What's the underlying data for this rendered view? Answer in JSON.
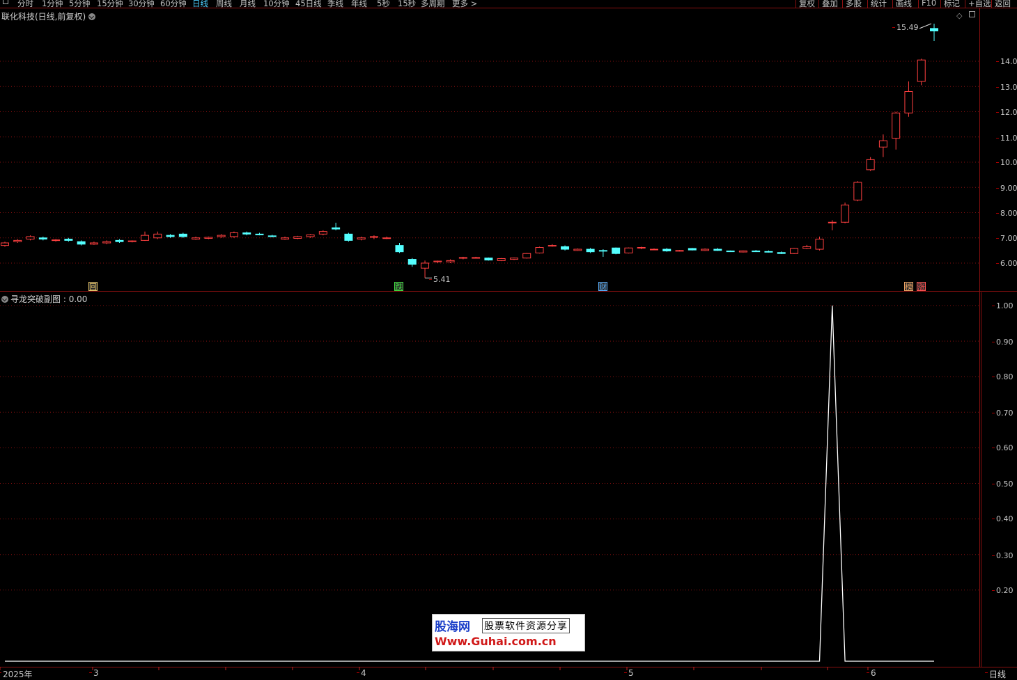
{
  "toolbar": {
    "period_tabs": [
      "分时",
      "1分钟",
      "5分钟",
      "15分钟",
      "30分钟",
      "60分钟",
      "日线",
      "周线",
      "月线",
      "10分钟",
      "45日线",
      "季线",
      "年线",
      "5秒",
      "15秒",
      "多周期",
      "更多 >"
    ],
    "active_period": "日线",
    "right_tabs": [
      "复权",
      "叠加",
      "多股",
      "统计",
      "画线",
      "F10",
      "标记",
      "+自选",
      "返回"
    ]
  },
  "price_panel": {
    "title": "联化科技(日线,前复权)",
    "y_ticks": [
      "14.00",
      "13.00",
      "12.00",
      "11.00",
      "10.00",
      "9.00",
      "8.00",
      "7.00",
      "6.00"
    ],
    "high_label": "15.49",
    "low_label": "5.41",
    "events": [
      {
        "label": "回",
        "color": "#e8c66a"
      },
      {
        "label": "跌",
        "color": "#40e040"
      },
      {
        "label": "财",
        "color": "#58b0ff"
      },
      {
        "label": "榜",
        "color": "#e8a060"
      },
      {
        "label": "涨",
        "color": "#ff5050"
      }
    ]
  },
  "indicator_panel": {
    "title": "寻龙突破副图",
    "value_sep": " : ",
    "value": "0.00",
    "y_ticks": [
      "1.00",
      "0.90",
      "0.80",
      "0.70",
      "0.60",
      "0.50",
      "0.40",
      "0.30",
      "0.20"
    ]
  },
  "x_axis": {
    "year_label": "2025年",
    "month_labels": [
      "3",
      "4",
      "5",
      "6"
    ],
    "period_button": "日线"
  },
  "watermark": {
    "logo": "股海网",
    "slogan": "股票软件资源分享",
    "url": "Www.Guhai.com.cn"
  },
  "colors": {
    "up": "#ff4040",
    "down": "#54ffff",
    "grid": "#8a1010",
    "indicator_line": "#ffffff",
    "active_tab": "#4fd0ff"
  },
  "chart_data": {
    "type": "candlestick",
    "ohlc": [
      [
        6.7,
        6.85,
        6.65,
        6.8
      ],
      [
        6.85,
        6.95,
        6.8,
        6.9
      ],
      [
        6.95,
        7.1,
        6.9,
        7.05
      ],
      [
        7.0,
        7.05,
        6.9,
        6.95
      ],
      [
        6.9,
        6.95,
        6.85,
        6.92
      ],
      [
        6.95,
        7.0,
        6.85,
        6.9
      ],
      [
        6.85,
        6.9,
        6.7,
        6.75
      ],
      [
        6.75,
        6.85,
        6.72,
        6.8
      ],
      [
        6.8,
        6.9,
        6.75,
        6.85
      ],
      [
        6.9,
        6.95,
        6.8,
        6.85
      ],
      [
        6.85,
        6.9,
        6.82,
        6.88
      ],
      [
        6.9,
        7.25,
        6.88,
        7.1
      ],
      [
        7.0,
        7.25,
        6.95,
        7.15
      ],
      [
        7.1,
        7.15,
        7.0,
        7.05
      ],
      [
        7.15,
        7.2,
        7.0,
        7.05
      ],
      [
        6.95,
        7.05,
        6.92,
        7.0
      ],
      [
        6.98,
        7.05,
        6.95,
        7.02
      ],
      [
        7.05,
        7.15,
        7.0,
        7.1
      ],
      [
        7.05,
        7.25,
        7.0,
        7.2
      ],
      [
        7.2,
        7.25,
        7.1,
        7.15
      ],
      [
        7.15,
        7.2,
        7.1,
        7.12
      ],
      [
        7.08,
        7.12,
        7.02,
        7.05
      ],
      [
        6.95,
        7.05,
        6.92,
        7.0
      ],
      [
        6.98,
        7.08,
        6.95,
        7.05
      ],
      [
        7.05,
        7.15,
        7.0,
        7.12
      ],
      [
        7.15,
        7.3,
        7.1,
        7.25
      ],
      [
        7.4,
        7.6,
        7.3,
        7.35
      ],
      [
        7.15,
        7.2,
        6.85,
        6.9
      ],
      [
        6.95,
        7.05,
        6.9,
        7.0
      ],
      [
        7.05,
        7.1,
        6.95,
        7.05
      ],
      [
        7.0,
        7.05,
        6.95,
        7.0
      ],
      [
        6.7,
        6.8,
        6.4,
        6.45
      ],
      [
        6.15,
        6.2,
        5.85,
        5.95
      ],
      [
        5.8,
        6.1,
        5.41,
        6.0
      ],
      [
        6.05,
        6.1,
        6.0,
        6.08
      ],
      [
        6.05,
        6.15,
        6.0,
        6.1
      ],
      [
        6.2,
        6.25,
        6.15,
        6.22
      ],
      [
        6.2,
        6.25,
        6.18,
        6.22
      ],
      [
        6.2,
        6.22,
        6.1,
        6.12
      ],
      [
        6.1,
        6.2,
        6.08,
        6.18
      ],
      [
        6.15,
        6.22,
        6.12,
        6.2
      ],
      [
        6.2,
        6.4,
        6.18,
        6.38
      ],
      [
        6.4,
        6.65,
        6.38,
        6.62
      ],
      [
        6.7,
        6.75,
        6.65,
        6.7
      ],
      [
        6.65,
        6.7,
        6.5,
        6.55
      ],
      [
        6.5,
        6.58,
        6.48,
        6.55
      ],
      [
        6.55,
        6.6,
        6.4,
        6.45
      ],
      [
        6.5,
        6.55,
        6.25,
        6.48
      ],
      [
        6.6,
        6.62,
        6.35,
        6.38
      ],
      [
        6.4,
        6.62,
        6.38,
        6.6
      ],
      [
        6.6,
        6.65,
        6.55,
        6.62
      ],
      [
        6.55,
        6.58,
        6.52,
        6.55
      ],
      [
        6.55,
        6.6,
        6.45,
        6.48
      ],
      [
        6.48,
        6.52,
        6.46,
        6.5
      ],
      [
        6.58,
        6.6,
        6.5,
        6.52
      ],
      [
        6.5,
        6.58,
        6.48,
        6.55
      ],
      [
        6.55,
        6.6,
        6.48,
        6.5
      ],
      [
        6.48,
        6.5,
        6.44,
        6.46
      ],
      [
        6.44,
        6.5,
        6.42,
        6.48
      ],
      [
        6.48,
        6.52,
        6.44,
        6.46
      ],
      [
        6.46,
        6.5,
        6.42,
        6.44
      ],
      [
        6.42,
        6.46,
        6.36,
        6.38
      ],
      [
        6.38,
        6.6,
        6.36,
        6.58
      ],
      [
        6.58,
        6.72,
        6.55,
        6.65
      ],
      [
        6.55,
        7.05,
        6.5,
        6.95
      ],
      [
        7.6,
        7.7,
        7.3,
        7.62
      ],
      [
        7.62,
        8.4,
        7.58,
        8.3
      ],
      [
        8.5,
        9.25,
        8.45,
        9.2
      ],
      [
        9.7,
        10.2,
        9.65,
        10.1
      ],
      [
        10.6,
        11.1,
        10.2,
        10.85
      ],
      [
        10.95,
        12.0,
        10.5,
        11.95
      ],
      [
        11.95,
        13.2,
        11.8,
        12.8
      ],
      [
        13.2,
        14.1,
        13.05,
        14.05
      ],
      [
        15.3,
        15.49,
        14.8,
        15.2
      ]
    ],
    "indicator": {
      "name": "寻龙突破副图",
      "ylim": [
        0,
        1.05
      ],
      "values": [
        0,
        0,
        0,
        0,
        0,
        0,
        0,
        0,
        0,
        0,
        0,
        0,
        0,
        0,
        0,
        0,
        0,
        0,
        0,
        0,
        0,
        0,
        0,
        0,
        0,
        0,
        0,
        0,
        0,
        0,
        0,
        0,
        0,
        0,
        0,
        0,
        0,
        0,
        0,
        0,
        0,
        0,
        0,
        0,
        0,
        0,
        0,
        0,
        0,
        0,
        0,
        0,
        0,
        0,
        0,
        0,
        0,
        0,
        0,
        0,
        0,
        0,
        0,
        0,
        0,
        1.0,
        0,
        0,
        0,
        0,
        0,
        0,
        0,
        0
      ]
    },
    "price_range": [
      5.2,
      16.0
    ]
  }
}
